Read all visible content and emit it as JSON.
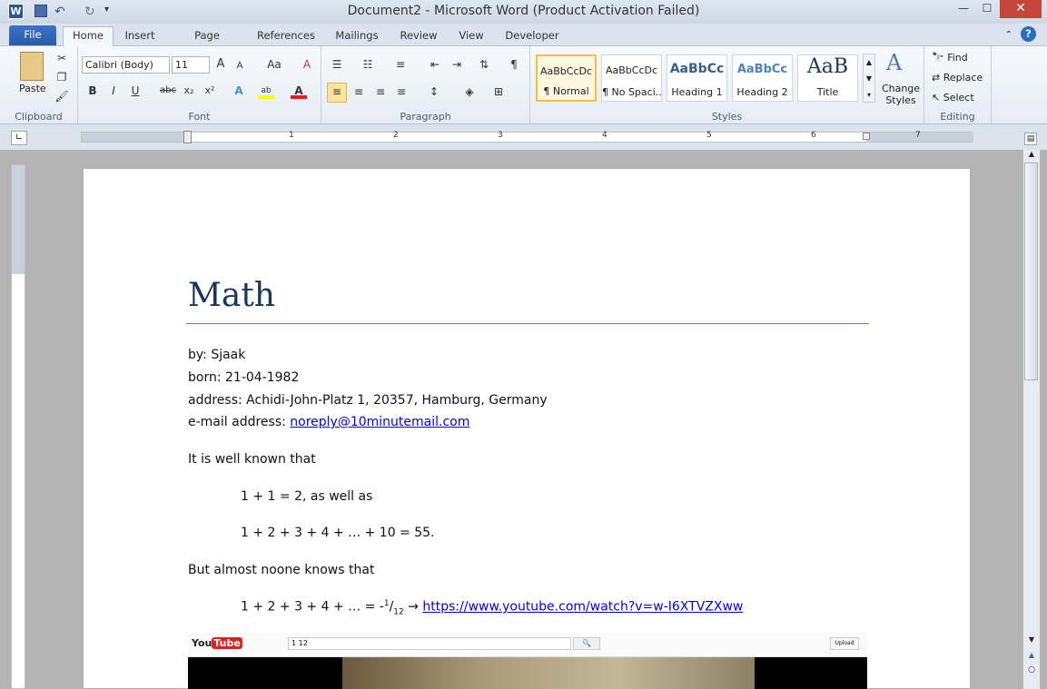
{
  "window": {
    "title": "Document2 - Microsoft Word (Product Activation Failed)",
    "app_icon_letter": "W",
    "controls": [
      "—",
      "☐",
      "✕"
    ]
  },
  "quick_access": [
    "save-icon",
    "undo-icon",
    "redo-icon",
    "customize-icon"
  ],
  "tabs": [
    {
      "label": "File"
    },
    {
      "label": "Home"
    },
    {
      "label": "Insert"
    },
    {
      "label": "Page Layout"
    },
    {
      "label": "References"
    },
    {
      "label": "Mailings"
    },
    {
      "label": "Review"
    },
    {
      "label": "View"
    },
    {
      "label": "Developer"
    }
  ],
  "ribbon": {
    "clipboard": {
      "label": "Clipboard",
      "paste": "Paste"
    },
    "font": {
      "label": "Font",
      "font_name": "Calibri (Body)",
      "font_size": "11",
      "bold": "B",
      "italic": "I",
      "underline": "U",
      "strike": "abc",
      "subscript": "x₂",
      "superscript": "x²",
      "grow": "A",
      "shrink": "A",
      "case": "Aa",
      "clear": "A"
    },
    "paragraph": {
      "label": "Paragraph",
      "pilcrow": "¶"
    },
    "styles": {
      "label": "Styles",
      "items": [
        {
          "preview": "AaBbCcDc",
          "label": "¶ Normal"
        },
        {
          "preview": "AaBbCcDc",
          "label": "¶ No Spaci..."
        },
        {
          "preview": "AaBbCc",
          "label": "Heading 1"
        },
        {
          "preview": "AaBbCc",
          "label": "Heading 2"
        },
        {
          "preview": "AaB",
          "label": "Title"
        }
      ],
      "change_styles": "Change Styles"
    },
    "editing": {
      "label": "Editing",
      "find": "Find",
      "replace": "Replace",
      "select": "Select"
    }
  },
  "ruler": {
    "numbers": [
      "1",
      "2",
      "3",
      "4",
      "5",
      "6",
      "7"
    ]
  },
  "document": {
    "title": "Math",
    "by": "by: Sjaak",
    "born": "born: 21-04-1982",
    "address": "address: Achidi-John-Platz 1, 20357, Hamburg, Germany",
    "email_label": "e-mail address: ",
    "email": "noreply@10minutemail.com",
    "intro": "It is well known that",
    "eq1": "1 + 1 = 2, as well as",
    "eq2": "1 + 2 + 3 + 4 + … + 10 = 55.",
    "but": "But almost noone knows that",
    "eq3_prefix": "1 + 2 + 3 + 4 + … = -",
    "eq3_num": "1",
    "eq3_slash": "/",
    "eq3_den": "12",
    "arrow": "→",
    "eq3_link": "https://www.youtube.com/watch?v=w-I6XTVZXww"
  },
  "embedded_video": {
    "logo_you": "You",
    "logo_tube": "Tube",
    "search": "1 12",
    "upload": "Upload"
  }
}
